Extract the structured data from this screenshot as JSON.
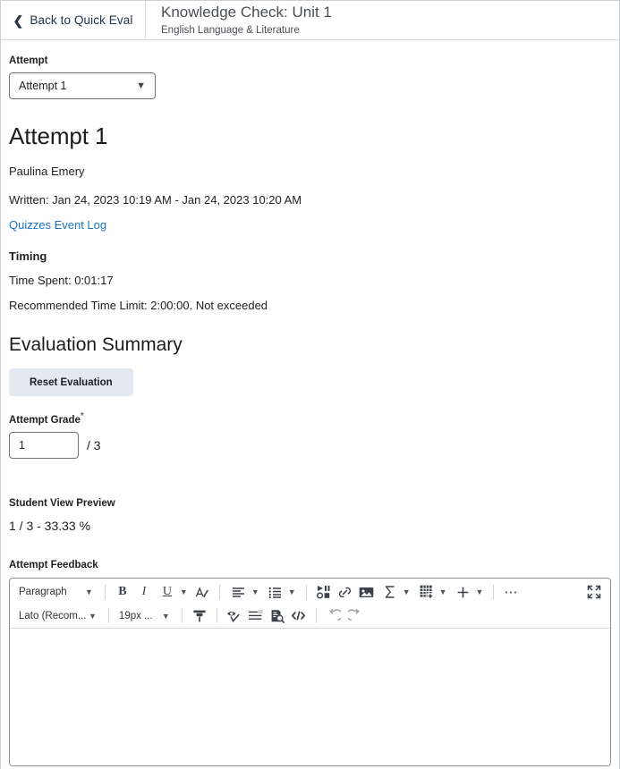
{
  "header": {
    "back_label": "Back to Quick Eval",
    "back_icon": "chevron-left-icon",
    "title": "Knowledge Check: Unit 1",
    "subtitle": "English Language & Literature"
  },
  "attempt_field": {
    "label": "Attempt",
    "selected": "Attempt 1",
    "options": [
      "Attempt 1"
    ],
    "chevron_icon": "chevron-down-icon"
  },
  "attempt_detail": {
    "heading": "Attempt 1",
    "student_name": "Paulina Emery",
    "written": "Written: Jan 24, 2023 10:19 AM - Jan 24, 2023 10:20 AM",
    "event_log_link": "Quizzes Event Log",
    "timing_heading": "Timing",
    "time_spent": "Time Spent: 0:01:17",
    "time_limit": "Recommended Time Limit: 2:00:00. Not exceeded"
  },
  "evaluation": {
    "heading": "Evaluation Summary",
    "reset_label": "Reset Evaluation",
    "grade_label": "Attempt Grade",
    "required_marker": "*",
    "grade_value": "1",
    "grade_denominator": "/ 3",
    "preview_label": "Student View Preview",
    "preview_value": "1 / 3 - 33.33 %"
  },
  "feedback": {
    "label": "Attempt Feedback",
    "editor_content": "",
    "toolbar_row1": {
      "paragraph_style": "Paragraph",
      "bold": "B",
      "italic": "I",
      "underline": "U",
      "text_color_icon": "text-color-icon",
      "align_icon": "align-left-icon",
      "list_icon": "bulleted-list-icon",
      "insert_stuff_icon": "insert-stuff-icon",
      "link_icon": "link-icon",
      "image_icon": "image-icon",
      "equation_icon": "equation-sigma-icon",
      "table_icon": "table-icon",
      "plus_icon": "plus-icon",
      "more_icon": "more-options-icon",
      "fullscreen_icon": "fullscreen-icon"
    },
    "toolbar_row2": {
      "font_family": "Lato (Recom...",
      "font_size": "19px ...",
      "format_painter_icon": "format-painter-icon",
      "accessibility_icon": "accessibility-checker-icon",
      "word_count_icon": "word-count-icon",
      "preview_icon": "document-preview-icon",
      "html_source_icon": "html-source-icon",
      "undo_icon": "undo-icon",
      "redo_icon": "redo-icon"
    },
    "resize_handle_icon": "resize-handle-icon"
  },
  "colors": {
    "link": "#1a73c4",
    "button_bg": "#e2e9f2",
    "border": "#6e7276",
    "text": "#202122"
  }
}
